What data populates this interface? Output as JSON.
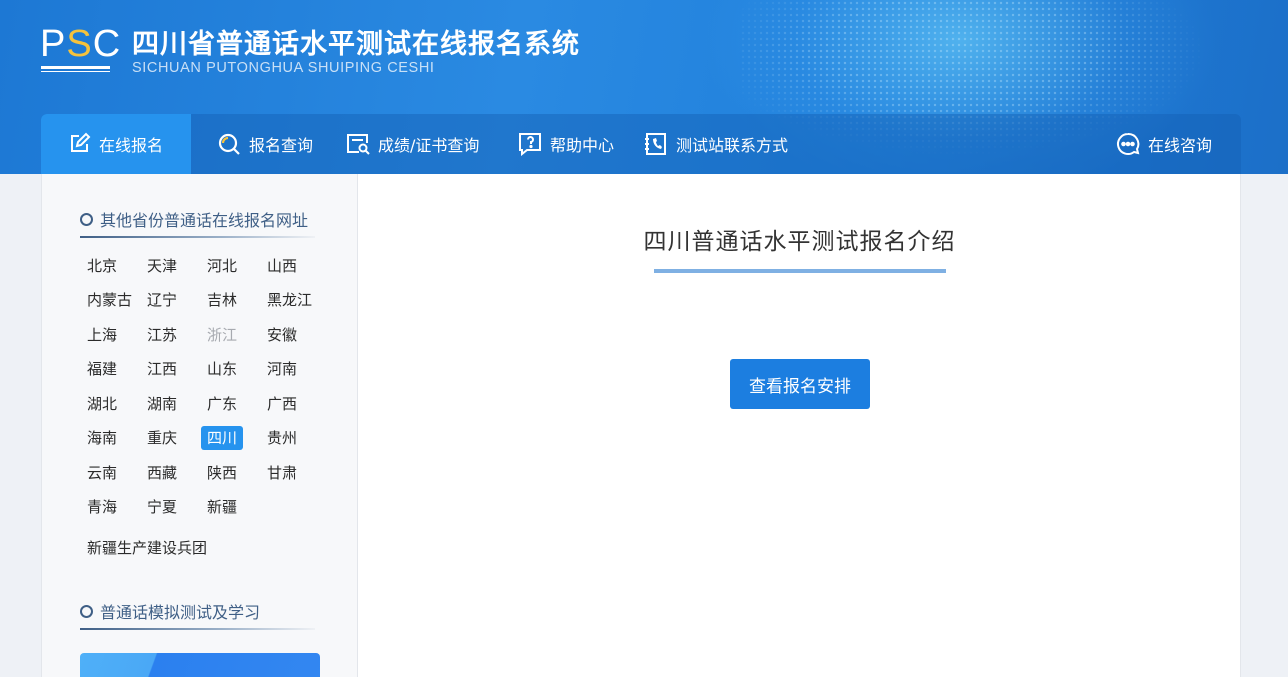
{
  "header": {
    "logo_text": "PSC",
    "title": "四川省普通话水平测试在线报名系统",
    "subtitle": "SICHUAN PUTONGHUA SHUIPING CESHI"
  },
  "nav": {
    "items": [
      {
        "label": "在线报名",
        "icon": "edit-icon",
        "active": true
      },
      {
        "label": "报名查询",
        "icon": "search-icon"
      },
      {
        "label": "成绩/证书查询",
        "icon": "certificate-search-icon"
      },
      {
        "label": "帮助中心",
        "icon": "help-icon"
      },
      {
        "label": "测试站联系方式",
        "icon": "phone-book-icon"
      }
    ],
    "consult": {
      "label": "在线咨询",
      "icon": "chat-icon"
    }
  },
  "sidebar": {
    "provinces_title": "其他省份普通话在线报名网址",
    "provinces": [
      "北京",
      "天津",
      "河北",
      "山西",
      "内蒙古",
      "辽宁",
      "吉林",
      "黑龙江",
      "上海",
      "江苏",
      "浙江",
      "安徽",
      "福建",
      "江西",
      "山东",
      "河南",
      "湖北",
      "湖南",
      "广东",
      "广西",
      "海南",
      "重庆",
      "四川",
      "贵州",
      "云南",
      "西藏",
      "陕西",
      "甘肃",
      "青海",
      "宁夏",
      "新疆"
    ],
    "corps": "新疆生产建设兵团",
    "current_province": "四川",
    "disabled_province": "浙江",
    "practice_title": "普通话模拟测试及学习"
  },
  "main": {
    "title": "四川普通话水平测试报名介绍",
    "button_label": "查看报名安排"
  },
  "colors": {
    "brand_blue": "#1c7ee0",
    "active_blue": "#2693ee",
    "logo_accent": "#f5c23c",
    "section_title": "#3f5f86"
  }
}
